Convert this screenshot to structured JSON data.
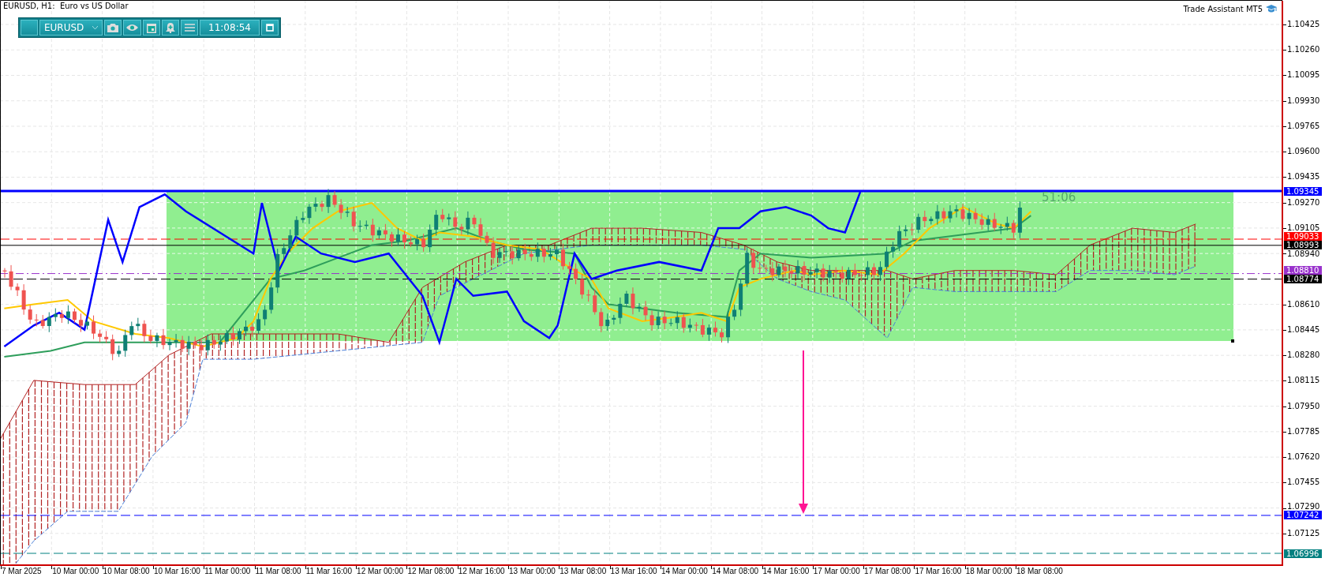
{
  "chart_title": "EURUSD, H1:  Euro vs US Dollar",
  "toolbar": {
    "symbol": "EURUSD",
    "time": "11:08:54"
  },
  "assistant_label": "Trade Assistant MT5",
  "countdown": "51:06",
  "price_ticks": [
    "1.10425",
    "1.10260",
    "1.10095",
    "1.09930",
    "1.09765",
    "1.09600",
    "1.09435",
    "1.09270",
    "1.09105",
    "1.08940",
    "1.08610",
    "1.08445",
    "1.08280",
    "1.08115",
    "1.07950",
    "1.07785",
    "1.07620",
    "1.07455",
    "1.07290",
    "1.07125"
  ],
  "price_lines": [
    {
      "label": "1.09345",
      "color": "#0000ff",
      "kind": "thick"
    },
    {
      "label": "1.09033",
      "color": "#ff0000",
      "kind": "dashed"
    },
    {
      "label": "1.08993",
      "color": "#000000",
      "kind": "solid"
    },
    {
      "label": "1.08810",
      "color": "#9932cc",
      "kind": "dashdot"
    },
    {
      "label": "1.08774",
      "color": "#000000",
      "kind": "dashed"
    },
    {
      "label": "1.07242",
      "color": "#0000ff",
      "kind": "dashed"
    },
    {
      "label": "1.06996",
      "color": "#008080",
      "kind": "dashed"
    }
  ],
  "time_labels": [
    "7 Mar 2025",
    "10 Mar 00:00",
    "10 Mar 08:00",
    "10 Mar 16:00",
    "11 Mar 00:00",
    "11 Mar 08:00",
    "11 Mar 16:00",
    "12 Mar 00:00",
    "12 Mar 08:00",
    "12 Mar 16:00",
    "13 Mar 00:00",
    "13 Mar 08:00",
    "13 Mar 16:00",
    "14 Mar 00:00",
    "14 Mar 08:00",
    "14 Mar 16:00",
    "17 Mar 00:00",
    "17 Mar 08:00",
    "17 Mar 16:00",
    "18 Mar 00:00",
    "18 Mar 08:00"
  ]
}
